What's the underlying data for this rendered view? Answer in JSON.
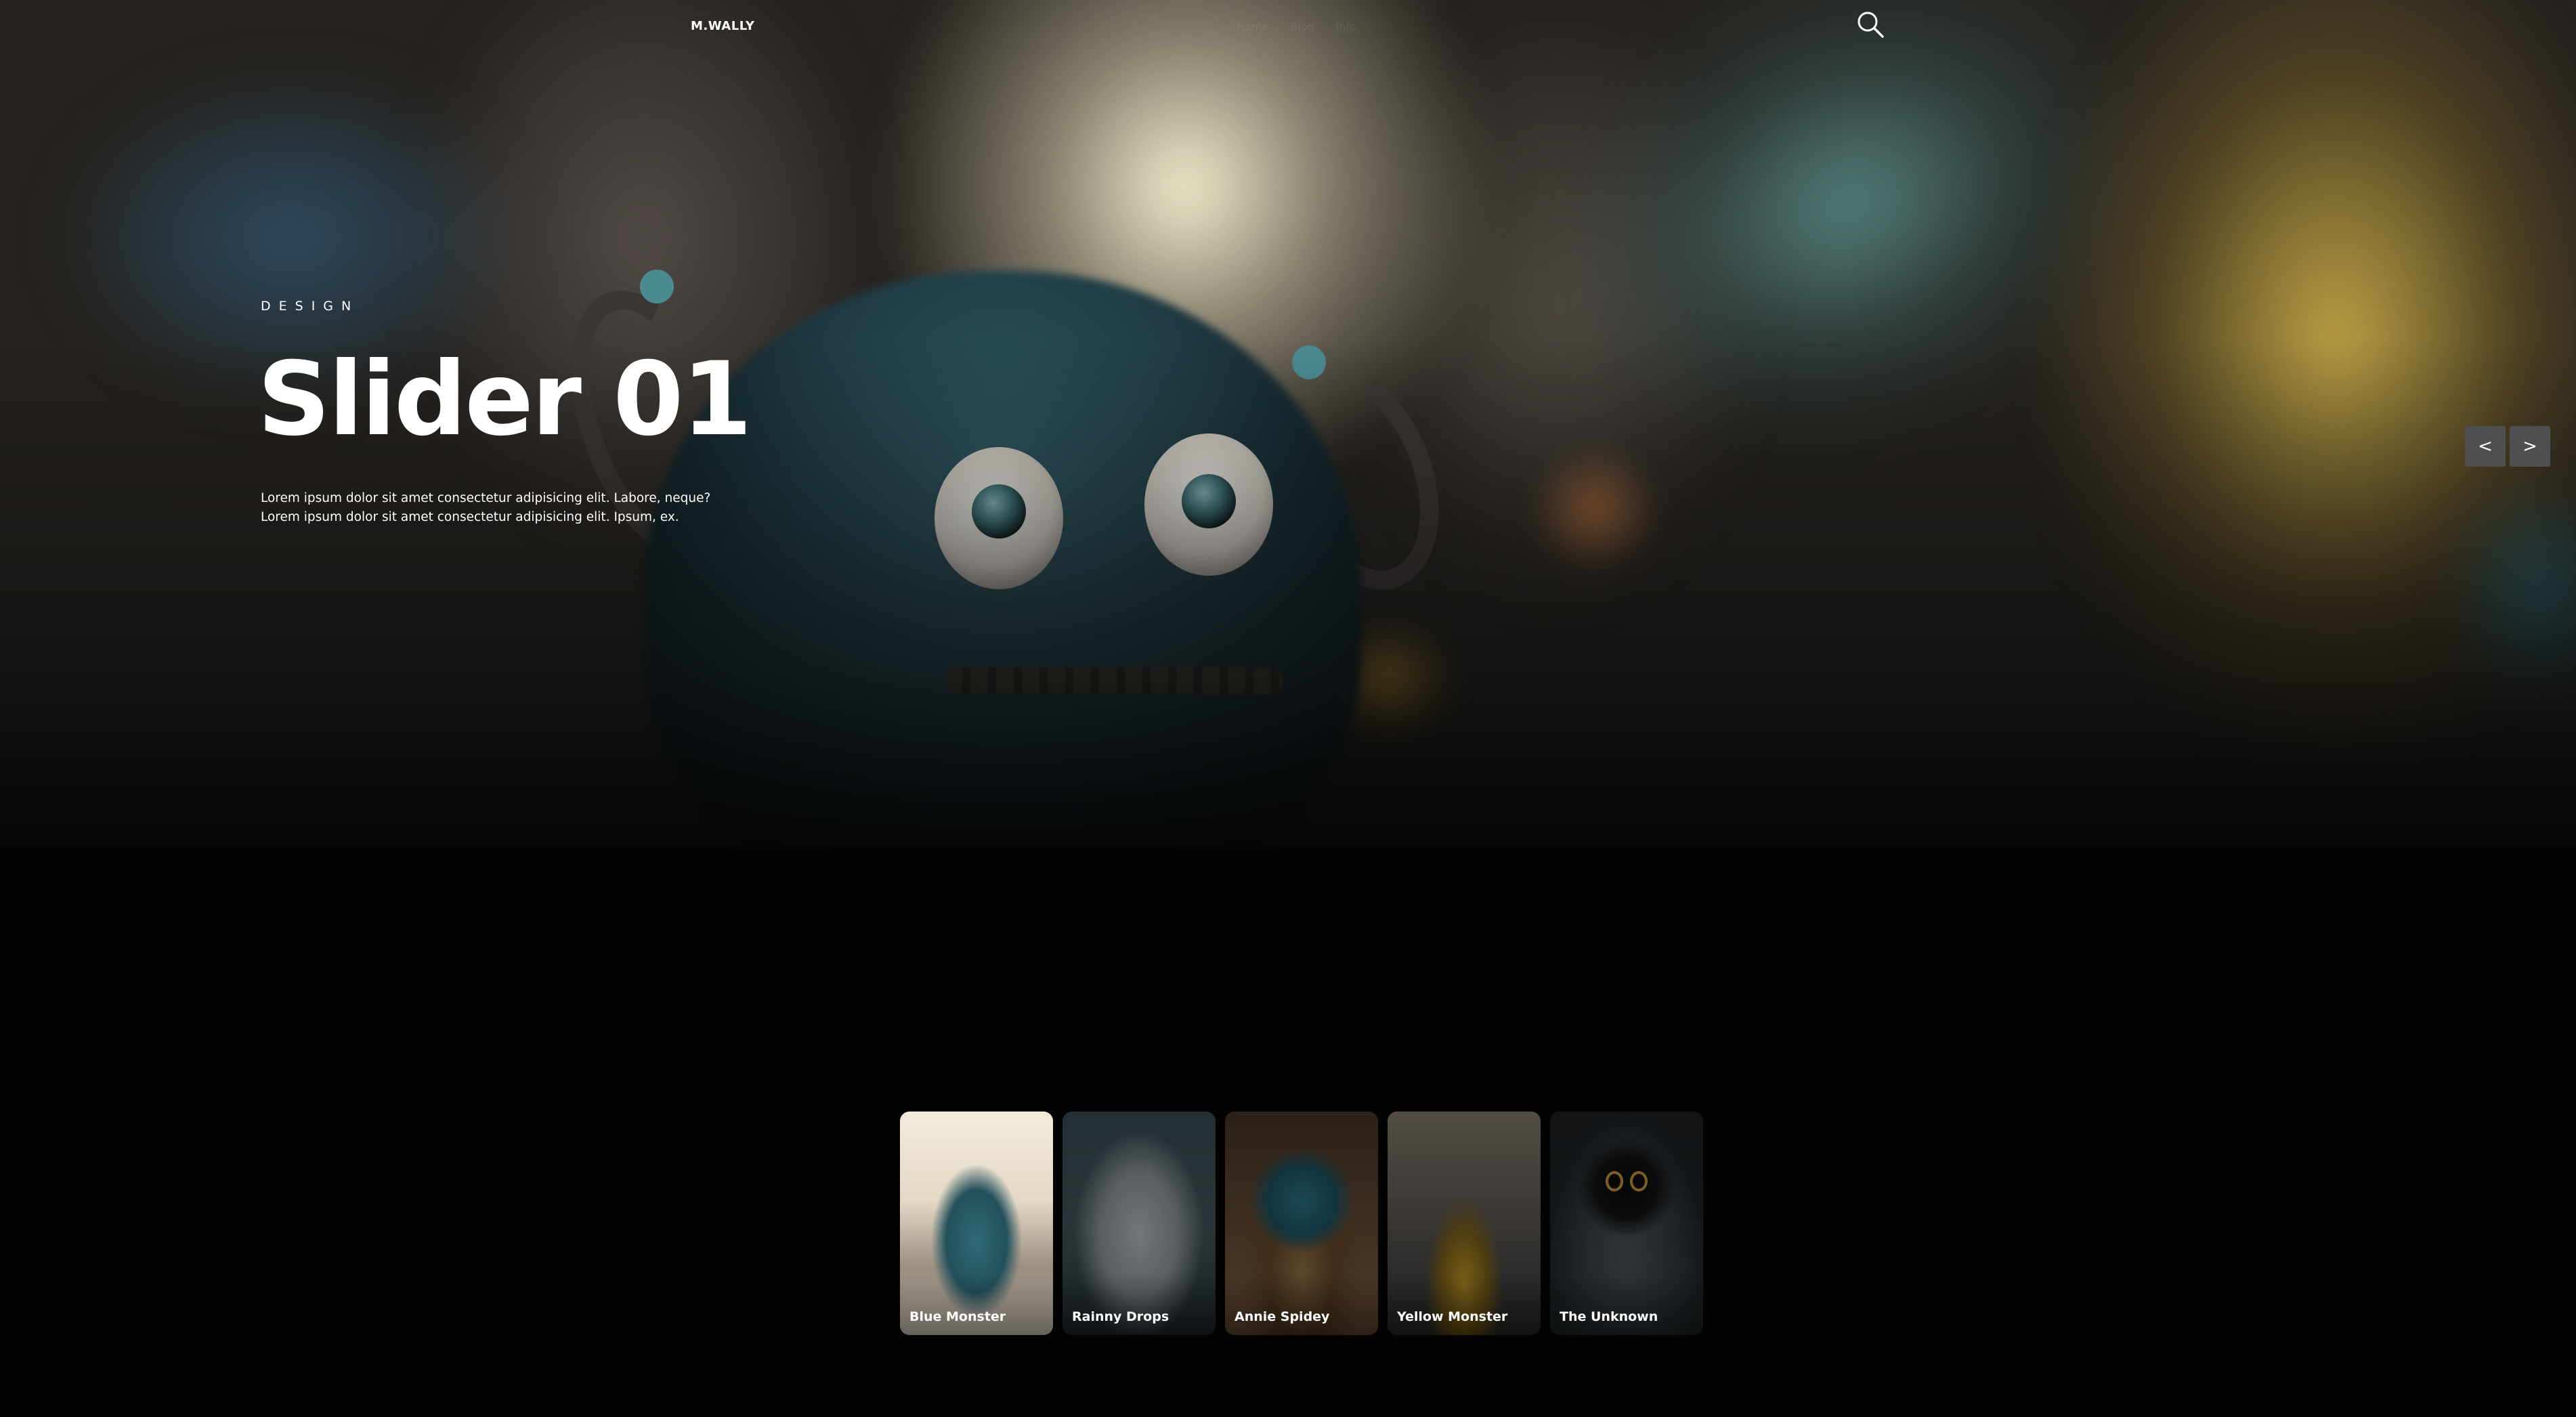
{
  "nav": {
    "logo": "M.WALLY",
    "links": [
      "Home",
      "Blog",
      "Info"
    ],
    "search_icon": "search-icon"
  },
  "hero": {
    "kicker": "DESIGN",
    "title": "Slider 01",
    "description": "Lorem ipsum dolor sit amet consectetur adipisicing elit. Labore, neque? Lorem ipsum dolor sit amet consectetur adipisicing elit. Ipsum, ex."
  },
  "controls": {
    "prev_label": "<",
    "next_label": ">"
  },
  "thumbnails": [
    {
      "caption": "Blue Monster",
      "active": true
    },
    {
      "caption": "Rainny Drops",
      "active": false
    },
    {
      "caption": "Annie Spidey",
      "active": false
    },
    {
      "caption": "Yellow Monster",
      "active": false
    },
    {
      "caption": "The Unknown",
      "active": false
    }
  ],
  "colors": {
    "background": "#030303",
    "text": "#ffffff",
    "arrow_button": "#4f4f4f"
  }
}
